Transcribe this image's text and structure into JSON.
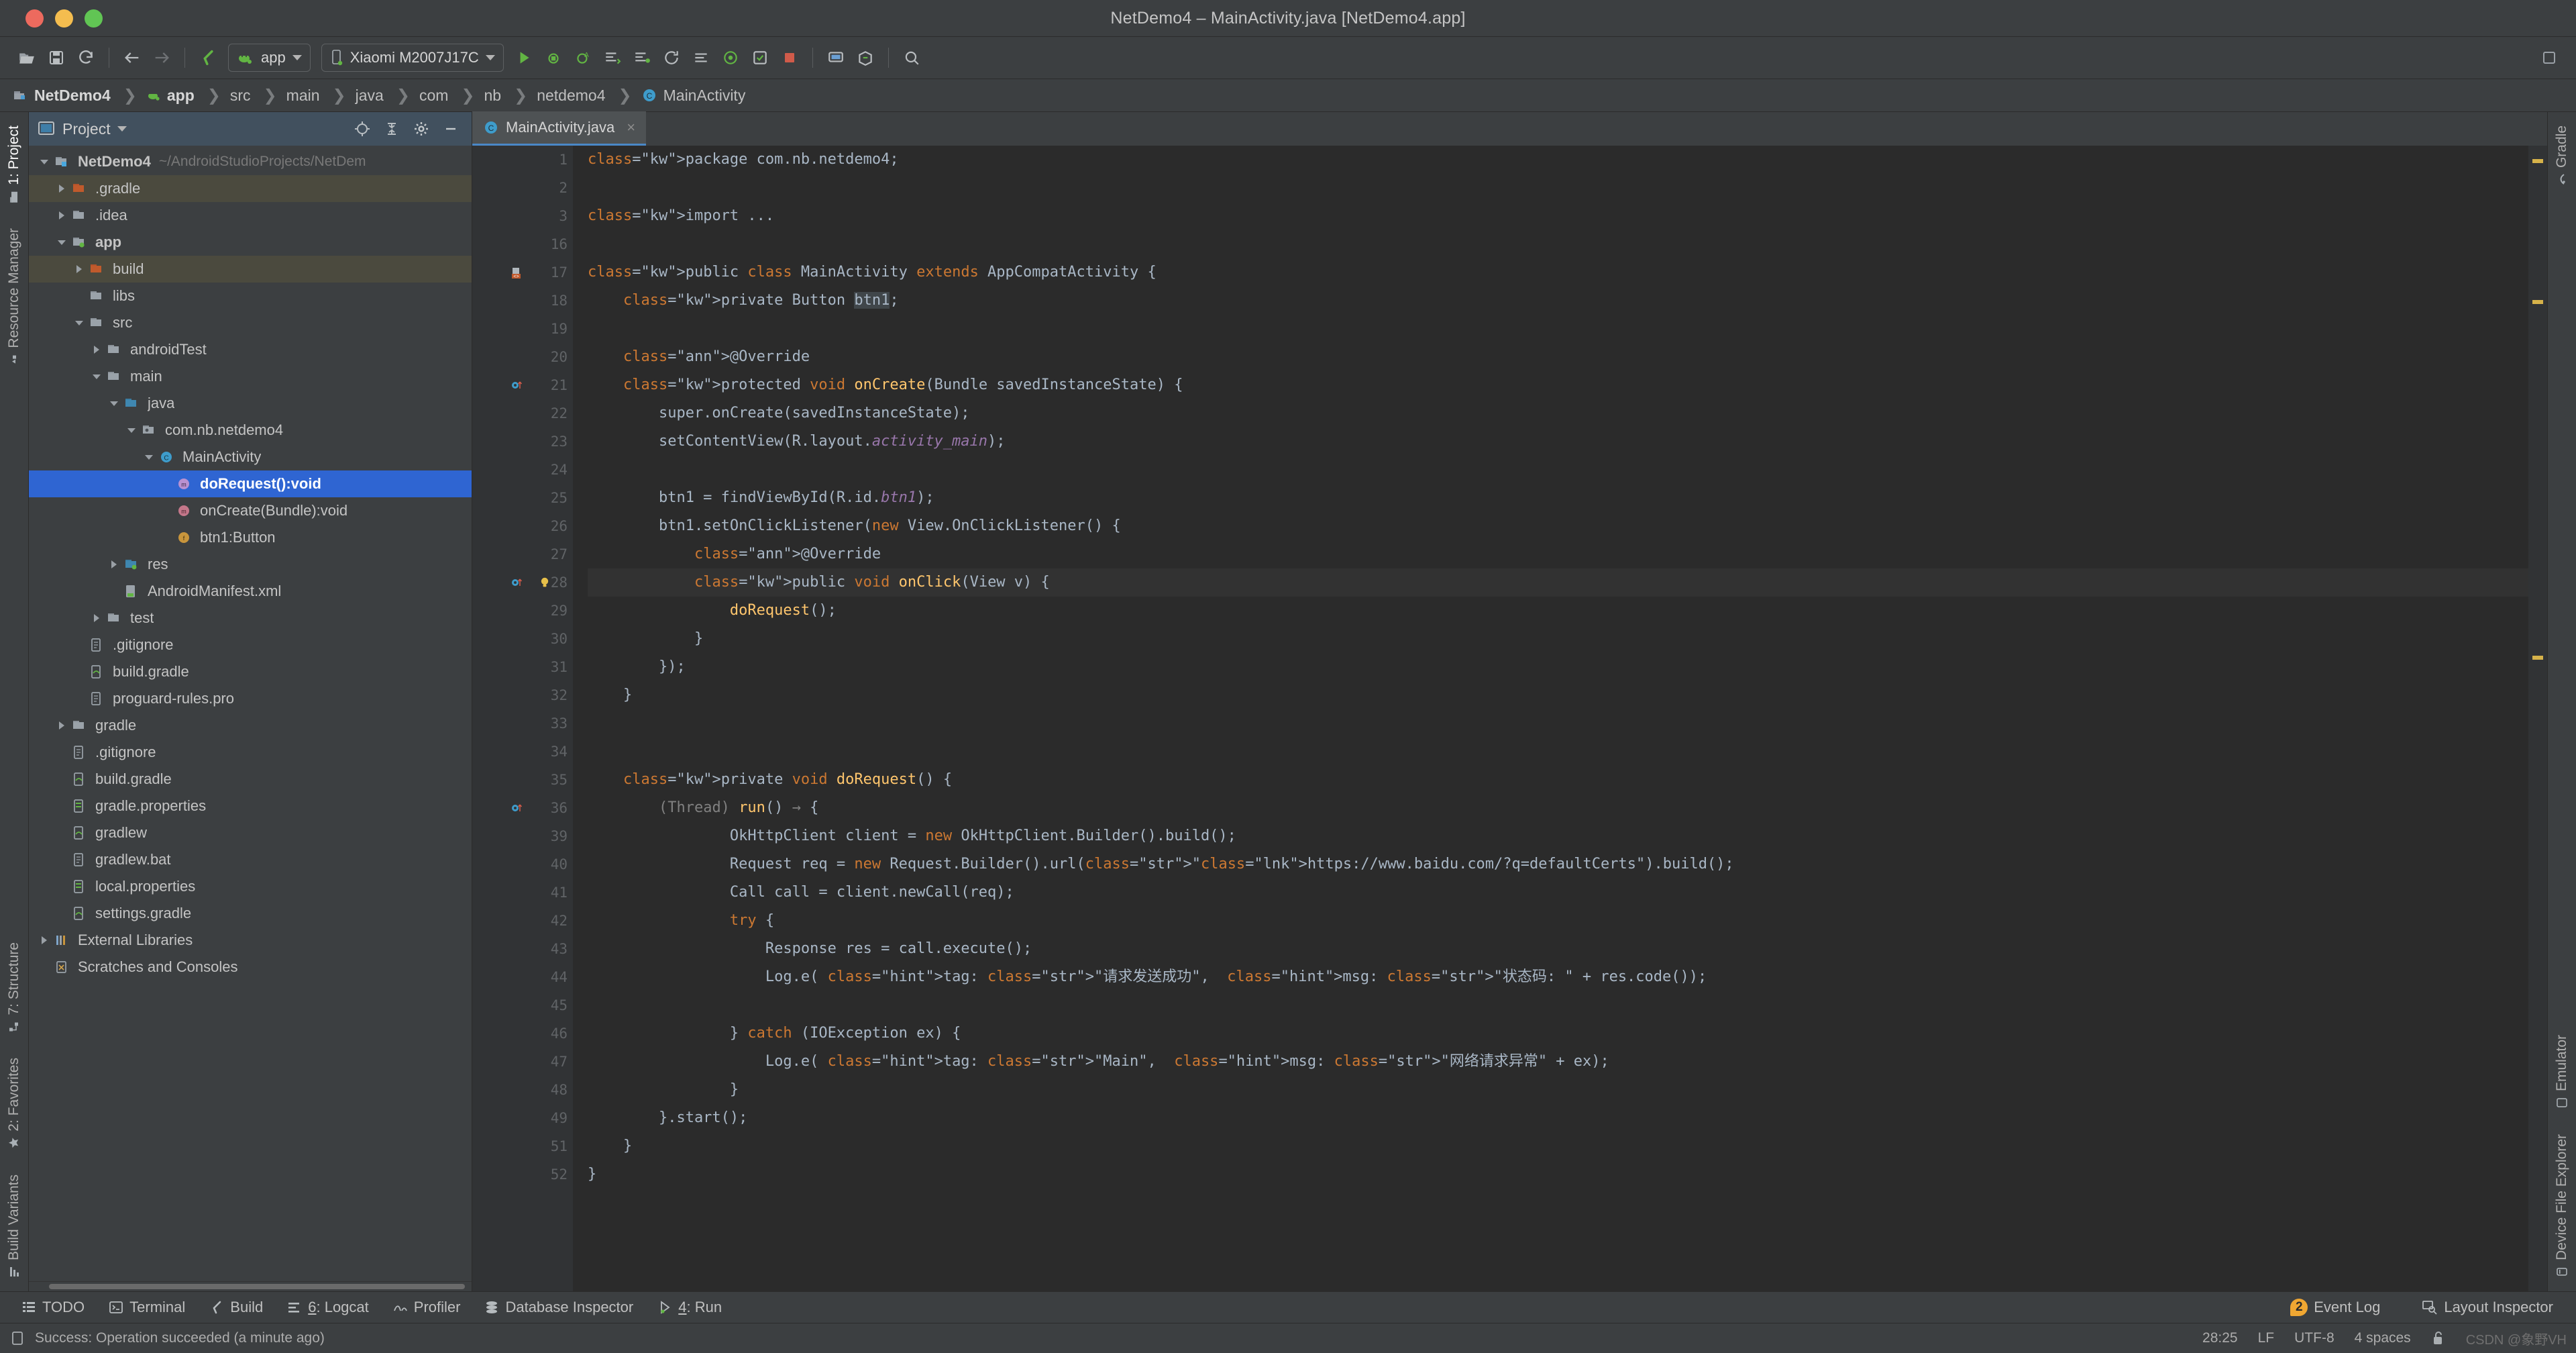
{
  "window": {
    "title": "NetDemo4 – MainActivity.java [NetDemo4.app]",
    "traffic": [
      "close-button",
      "minimize-button",
      "zoom-button"
    ]
  },
  "toolbar": {
    "open_label": "Open",
    "save_label": "Save All",
    "sync_label": "Sync Project with Gradle Files",
    "back_label": "Back",
    "forward_label": "Forward",
    "build_label": "Make Project",
    "module_selector": "app",
    "device_selector": "Xiaomi M2007J17C",
    "run_label": "Run",
    "debug_label": "Debug",
    "profile_label": "Profile",
    "apply_changes_label": "Apply Changes",
    "stop_label": "Stop",
    "avd_label": "AVD Manager",
    "sdk_label": "SDK Manager",
    "search_label": "Search Everywhere"
  },
  "breadcrumb": [
    {
      "label": "NetDemo4",
      "bold": true,
      "icon": "project-icon"
    },
    {
      "label": "app",
      "bold": true,
      "icon": "module-icon"
    },
    {
      "label": "src",
      "bold": false,
      "icon": ""
    },
    {
      "label": "main",
      "bold": false,
      "icon": ""
    },
    {
      "label": "java",
      "bold": false,
      "icon": ""
    },
    {
      "label": "com",
      "bold": false,
      "icon": ""
    },
    {
      "label": "nb",
      "bold": false,
      "icon": ""
    },
    {
      "label": "netdemo4",
      "bold": false,
      "icon": ""
    },
    {
      "label": "MainActivity",
      "bold": false,
      "icon": "class-icon"
    }
  ],
  "left_rail": [
    {
      "label": "1: Project",
      "icon": "project-folder-icon",
      "selected": true
    },
    {
      "label": "Resource Manager",
      "icon": "resource-icon",
      "selected": false
    }
  ],
  "left_rail_bottom": [
    {
      "label": "7: Structure",
      "icon": "structure-icon"
    },
    {
      "label": "2: Favorites",
      "icon": "star-icon"
    },
    {
      "label": "Build Variants",
      "icon": "variants-icon"
    }
  ],
  "right_rail": [
    {
      "label": "Gradle",
      "icon": "gradle-icon"
    }
  ],
  "right_rail_bottom": [
    {
      "label": "Emulator",
      "icon": "emulator-icon"
    },
    {
      "label": "Device File Explorer",
      "icon": "device-file-icon"
    }
  ],
  "project_panel": {
    "title": "Project",
    "title_icon": "project-view-icon",
    "buttons": [
      "locate-icon",
      "collapse-all-icon",
      "settings-gear-icon",
      "hide-icon"
    ],
    "tree": [
      {
        "depth": 0,
        "twisty": "down",
        "icon": "project-root-icon",
        "label": "NetDemo4",
        "bold": true,
        "sub": "~/AndroidStudioProjects/NetDem",
        "state": "normal"
      },
      {
        "depth": 1,
        "twisty": "right",
        "icon": "folder-orange-icon",
        "label": ".gradle",
        "bold": false,
        "sub": "",
        "state": "highlight"
      },
      {
        "depth": 1,
        "twisty": "right",
        "icon": "folder-icon",
        "label": ".idea",
        "bold": false,
        "sub": "",
        "state": "normal"
      },
      {
        "depth": 1,
        "twisty": "down",
        "icon": "folder-module-icon",
        "label": "app",
        "bold": true,
        "sub": "",
        "state": "normal"
      },
      {
        "depth": 2,
        "twisty": "right",
        "icon": "folder-orange-icon",
        "label": "build",
        "bold": false,
        "sub": "",
        "state": "highlight"
      },
      {
        "depth": 2,
        "twisty": "none",
        "icon": "folder-icon",
        "label": "libs",
        "bold": false,
        "sub": "",
        "state": "normal"
      },
      {
        "depth": 2,
        "twisty": "down",
        "icon": "folder-icon",
        "label": "src",
        "bold": false,
        "sub": "",
        "state": "normal"
      },
      {
        "depth": 3,
        "twisty": "right",
        "icon": "folder-icon",
        "label": "androidTest",
        "bold": false,
        "sub": "",
        "state": "normal"
      },
      {
        "depth": 3,
        "twisty": "down",
        "icon": "folder-icon",
        "label": "main",
        "bold": false,
        "sub": "",
        "state": "normal"
      },
      {
        "depth": 4,
        "twisty": "down",
        "icon": "folder-source-icon",
        "label": "java",
        "bold": false,
        "sub": "",
        "state": "normal"
      },
      {
        "depth": 5,
        "twisty": "down",
        "icon": "package-icon",
        "label": "com.nb.netdemo4",
        "bold": false,
        "sub": "",
        "state": "normal"
      },
      {
        "depth": 6,
        "twisty": "down",
        "icon": "class-icon",
        "label": "MainActivity",
        "bold": false,
        "sub": "",
        "state": "normal"
      },
      {
        "depth": 7,
        "twisty": "none",
        "icon": "method-purple-icon",
        "label": "doRequest():void",
        "bold": true,
        "sub": "",
        "state": "selected"
      },
      {
        "depth": 7,
        "twisty": "none",
        "icon": "method-red-icon",
        "label": "onCreate(Bundle):void",
        "bold": false,
        "sub": "",
        "state": "normal"
      },
      {
        "depth": 7,
        "twisty": "none",
        "icon": "field-icon",
        "label": "btn1:Button",
        "bold": false,
        "sub": "",
        "state": "normal"
      },
      {
        "depth": 4,
        "twisty": "right",
        "icon": "folder-res-icon",
        "label": "res",
        "bold": false,
        "sub": "",
        "state": "normal"
      },
      {
        "depth": 4,
        "twisty": "none",
        "icon": "xml-icon",
        "label": "AndroidManifest.xml",
        "bold": false,
        "sub": "",
        "state": "normal"
      },
      {
        "depth": 3,
        "twisty": "right",
        "icon": "folder-icon",
        "label": "test",
        "bold": false,
        "sub": "",
        "state": "normal"
      },
      {
        "depth": 2,
        "twisty": "none",
        "icon": "file-icon",
        "label": ".gitignore",
        "bold": false,
        "sub": "",
        "state": "normal"
      },
      {
        "depth": 2,
        "twisty": "none",
        "icon": "gradle-file-icon",
        "label": "build.gradle",
        "bold": false,
        "sub": "",
        "state": "normal"
      },
      {
        "depth": 2,
        "twisty": "none",
        "icon": "file-icon",
        "label": "proguard-rules.pro",
        "bold": false,
        "sub": "",
        "state": "normal"
      },
      {
        "depth": 1,
        "twisty": "right",
        "icon": "folder-icon",
        "label": "gradle",
        "bold": false,
        "sub": "",
        "state": "normal"
      },
      {
        "depth": 1,
        "twisty": "none",
        "icon": "file-icon",
        "label": ".gitignore",
        "bold": false,
        "sub": "",
        "state": "normal"
      },
      {
        "depth": 1,
        "twisty": "none",
        "icon": "gradle-file-icon",
        "label": "build.gradle",
        "bold": false,
        "sub": "",
        "state": "normal"
      },
      {
        "depth": 1,
        "twisty": "none",
        "icon": "properties-icon",
        "label": "gradle.properties",
        "bold": false,
        "sub": "",
        "state": "normal"
      },
      {
        "depth": 1,
        "twisty": "none",
        "icon": "gradle-file-icon",
        "label": "gradlew",
        "bold": false,
        "sub": "",
        "state": "normal"
      },
      {
        "depth": 1,
        "twisty": "none",
        "icon": "file-icon",
        "label": "gradlew.bat",
        "bold": false,
        "sub": "",
        "state": "normal"
      },
      {
        "depth": 1,
        "twisty": "none",
        "icon": "properties-icon",
        "label": "local.properties",
        "bold": false,
        "sub": "",
        "state": "normal"
      },
      {
        "depth": 1,
        "twisty": "none",
        "icon": "gradle-file-icon",
        "label": "settings.gradle",
        "bold": false,
        "sub": "",
        "state": "normal"
      },
      {
        "depth": 0,
        "twisty": "right",
        "icon": "library-icon",
        "label": "External Libraries",
        "bold": false,
        "sub": "",
        "state": "normal"
      },
      {
        "depth": 0,
        "twisty": "none",
        "icon": "scratch-icon",
        "label": "Scratches and Consoles",
        "bold": false,
        "sub": "",
        "state": "normal"
      }
    ]
  },
  "editor": {
    "tab": {
      "label": "MainActivity.java",
      "icon": "class-icon",
      "close": "×"
    },
    "lines": [
      {
        "n": "1",
        "gutter": "",
        "fold": "",
        "hl": false
      },
      {
        "n": "2",
        "gutter": "",
        "fold": "",
        "hl": false
      },
      {
        "n": "3",
        "gutter": "",
        "fold": "+",
        "hl": false
      },
      {
        "n": "16",
        "gutter": "",
        "fold": "",
        "hl": false
      },
      {
        "n": "17",
        "gutter": "class-marker",
        "fold": "",
        "hl": false
      },
      {
        "n": "18",
        "gutter": "",
        "fold": "",
        "hl": false
      },
      {
        "n": "19",
        "gutter": "",
        "fold": "",
        "hl": false
      },
      {
        "n": "20",
        "gutter": "",
        "fold": "",
        "hl": false
      },
      {
        "n": "21",
        "gutter": "override-marker",
        "fold": "−",
        "hl": false
      },
      {
        "n": "22",
        "gutter": "",
        "fold": "",
        "hl": false
      },
      {
        "n": "23",
        "gutter": "",
        "fold": "",
        "hl": false
      },
      {
        "n": "24",
        "gutter": "",
        "fold": "",
        "hl": false
      },
      {
        "n": "25",
        "gutter": "",
        "fold": "",
        "hl": false
      },
      {
        "n": "26",
        "gutter": "",
        "fold": "",
        "hl": false
      },
      {
        "n": "27",
        "gutter": "",
        "fold": "",
        "hl": false
      },
      {
        "n": "28",
        "gutter": "override-marker-bulb",
        "fold": "",
        "hl": true
      },
      {
        "n": "29",
        "gutter": "",
        "fold": "",
        "hl": false
      },
      {
        "n": "30",
        "gutter": "",
        "fold": "",
        "hl": false
      },
      {
        "n": "31",
        "gutter": "",
        "fold": "⊟",
        "hl": false
      },
      {
        "n": "32",
        "gutter": "",
        "fold": "⊟",
        "hl": false
      },
      {
        "n": "33",
        "gutter": "",
        "fold": "",
        "hl": false
      },
      {
        "n": "34",
        "gutter": "",
        "fold": "",
        "hl": false
      },
      {
        "n": "35",
        "gutter": "",
        "fold": "",
        "hl": false
      },
      {
        "n": "36",
        "gutter": "override-marker",
        "fold": "−",
        "hl": false
      },
      {
        "n": "39",
        "gutter": "",
        "fold": "",
        "hl": false
      },
      {
        "n": "40",
        "gutter": "",
        "fold": "",
        "hl": false
      },
      {
        "n": "41",
        "gutter": "",
        "fold": "",
        "hl": false
      },
      {
        "n": "42",
        "gutter": "",
        "fold": "−",
        "hl": false
      },
      {
        "n": "43",
        "gutter": "",
        "fold": "",
        "hl": false
      },
      {
        "n": "44",
        "gutter": "",
        "fold": "",
        "hl": false
      },
      {
        "n": "45",
        "gutter": "",
        "fold": "",
        "hl": false
      },
      {
        "n": "46",
        "gutter": "",
        "fold": "−",
        "hl": false
      },
      {
        "n": "47",
        "gutter": "",
        "fold": "",
        "hl": false
      },
      {
        "n": "48",
        "gutter": "",
        "fold": "",
        "hl": false
      },
      {
        "n": "49",
        "gutter": "",
        "fold": "⊟",
        "hl": false
      },
      {
        "n": "51",
        "gutter": "",
        "fold": "⊟",
        "hl": false
      },
      {
        "n": "52",
        "gutter": "",
        "fold": "",
        "hl": false
      }
    ],
    "code": [
      "package com.nb.netdemo4;",
      "",
      "import ...",
      "",
      "public class MainActivity extends AppCompatActivity {",
      "    private Button btn1;",
      "",
      "    @Override",
      "    protected void onCreate(Bundle savedInstanceState) {",
      "        super.onCreate(savedInstanceState);",
      "        setContentView(R.layout.activity_main);",
      "",
      "        btn1 = findViewById(R.id.btn1);",
      "        btn1.setOnClickListener(new View.OnClickListener() {",
      "            @Override",
      "            public void onClick(View v) {",
      "                doRequest();",
      "            }",
      "        });",
      "    }",
      "",
      "",
      "    private void doRequest() {",
      "        (Thread) run() → {",
      "                OkHttpClient client = new OkHttpClient.Builder().build();",
      "                Request req = new Request.Builder().url(\"https://www.baidu.com/?q=defaultCerts\").build();",
      "                Call call = client.newCall(req);",
      "                try {",
      "                    Response res = call.execute();",
      "                    Log.e( tag: \"请求发送成功\",  msg: \"状态码: \" + res.code());",
      "",
      "                } catch (IOException ex) {",
      "                    Log.e( tag: \"Main\",  msg: \"网络请求异常\" + ex);",
      "                }",
      "        }.start();",
      "    }",
      "}"
    ],
    "url_literal": "https://www.baidu.com/?q=defaultCerts",
    "string_literals": [
      "请求发送成功",
      "状态码: ",
      "Main",
      "网络请求异常"
    ],
    "param_hints": [
      "tag:",
      "msg:"
    ]
  },
  "tool_windows": [
    {
      "label": "TODO",
      "icon": "todo-icon",
      "num": ""
    },
    {
      "label": "Terminal",
      "icon": "terminal-icon",
      "num": ""
    },
    {
      "label": "Build",
      "icon": "build-icon",
      "num": ""
    },
    {
      "label": "Logcat",
      "icon": "logcat-icon",
      "num": "6"
    },
    {
      "label": "Profiler",
      "icon": "profiler-icon",
      "num": ""
    },
    {
      "label": "Database Inspector",
      "icon": "database-icon",
      "num": ""
    },
    {
      "label": "Run",
      "icon": "run-icon",
      "num": "4"
    }
  ],
  "tool_windows_right": [
    {
      "label": "Event Log",
      "icon": "event-log-icon",
      "badge": "2"
    },
    {
      "label": "Layout Inspector",
      "icon": "layout-inspector-icon",
      "badge": ""
    }
  ],
  "status": {
    "message": "Success: Operation succeeded (a minute ago)",
    "message_icon": "build-status-icon",
    "caret": "28:25",
    "line_sep": "LF",
    "encoding": "UTF-8",
    "indent": "4 spaces",
    "lock_icon": "unlocked-icon",
    "watermark": "CSDN @象野VH"
  },
  "colors": {
    "bg": "#3c3f41",
    "editor_bg": "#2b2b2b",
    "gutter_bg": "#313335",
    "selection": "#2f65d2",
    "highlight_row": "#4b4a3e",
    "accent": "#4a88c7",
    "keyword": "#cc7832",
    "string": "#6a8759",
    "number": "#6897bb",
    "annotation": "#bbb529",
    "method": "#ffc66d",
    "field": "#9876aa",
    "comment": "#808080",
    "badge": "#f0a732",
    "green": "#62b543"
  }
}
